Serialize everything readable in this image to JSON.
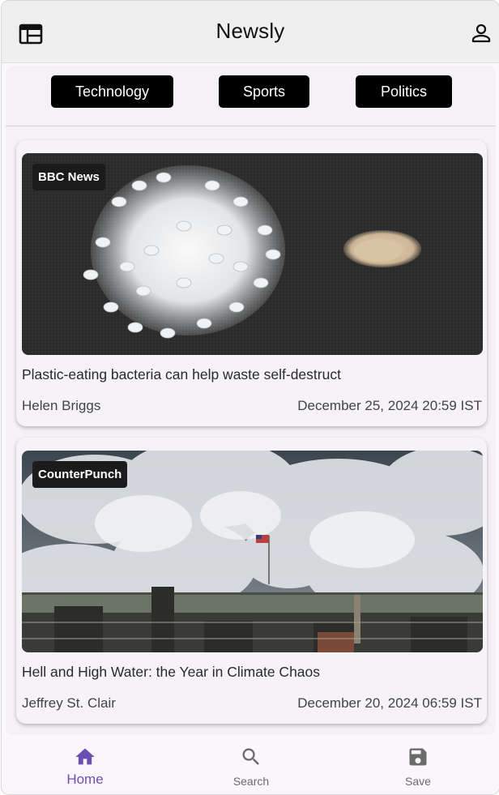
{
  "app": {
    "title": "Newsly"
  },
  "header": {
    "menu_icon": "newspaper-icon",
    "profile_icon": "person-icon"
  },
  "categories": [
    "Technology",
    "Sports",
    "Politics"
  ],
  "articles": [
    {
      "source": "BBC News",
      "headline": "Plastic-eating bacteria can help waste self-destruct",
      "author": "Helen Briggs",
      "date": "December 25, 2024 20:59 IST"
    },
    {
      "source": "CounterPunch",
      "headline": "Hell and High Water: the Year in Climate Chaos",
      "author": "Jeffrey St. Clair",
      "date": "December 20, 2024 06:59 IST"
    }
  ],
  "nav": {
    "home": "Home",
    "search": "Search",
    "save": "Save",
    "active": "Home"
  },
  "colors": {
    "accent": "#6a4fb0",
    "chip_bg": "#000000",
    "nav_inactive": "#6b6b6b"
  }
}
